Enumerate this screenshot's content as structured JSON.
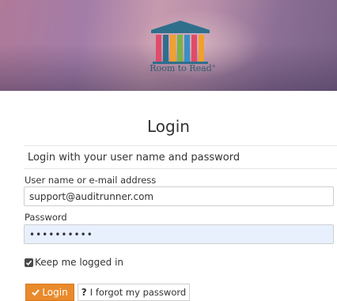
{
  "banner": {
    "logo_text": "Room to Read",
    "logo_mark": "®",
    "logo_icon": "library-columns-icon",
    "colors": {
      "roof": "#2f6f8c",
      "col1": "#e04b6a",
      "col2": "#f1a02b",
      "col3": "#7bb443",
      "col4": "#3a8fc4",
      "col5": "#e04b6a",
      "col6": "#f1a02b"
    }
  },
  "login": {
    "title": "Login",
    "subtitle": "Login with your user name and password",
    "username_label": "User name or e-mail address",
    "username_value": "support@auditrunner.com",
    "password_label": "Password",
    "password_value": "••••••••••",
    "remember_label": "Keep me logged in",
    "remember_checked": true,
    "login_button": "Login",
    "forgot_button": "I forgot my password"
  },
  "colors": {
    "accent": "#e98a2c",
    "autofill": "#e8f0fe"
  }
}
